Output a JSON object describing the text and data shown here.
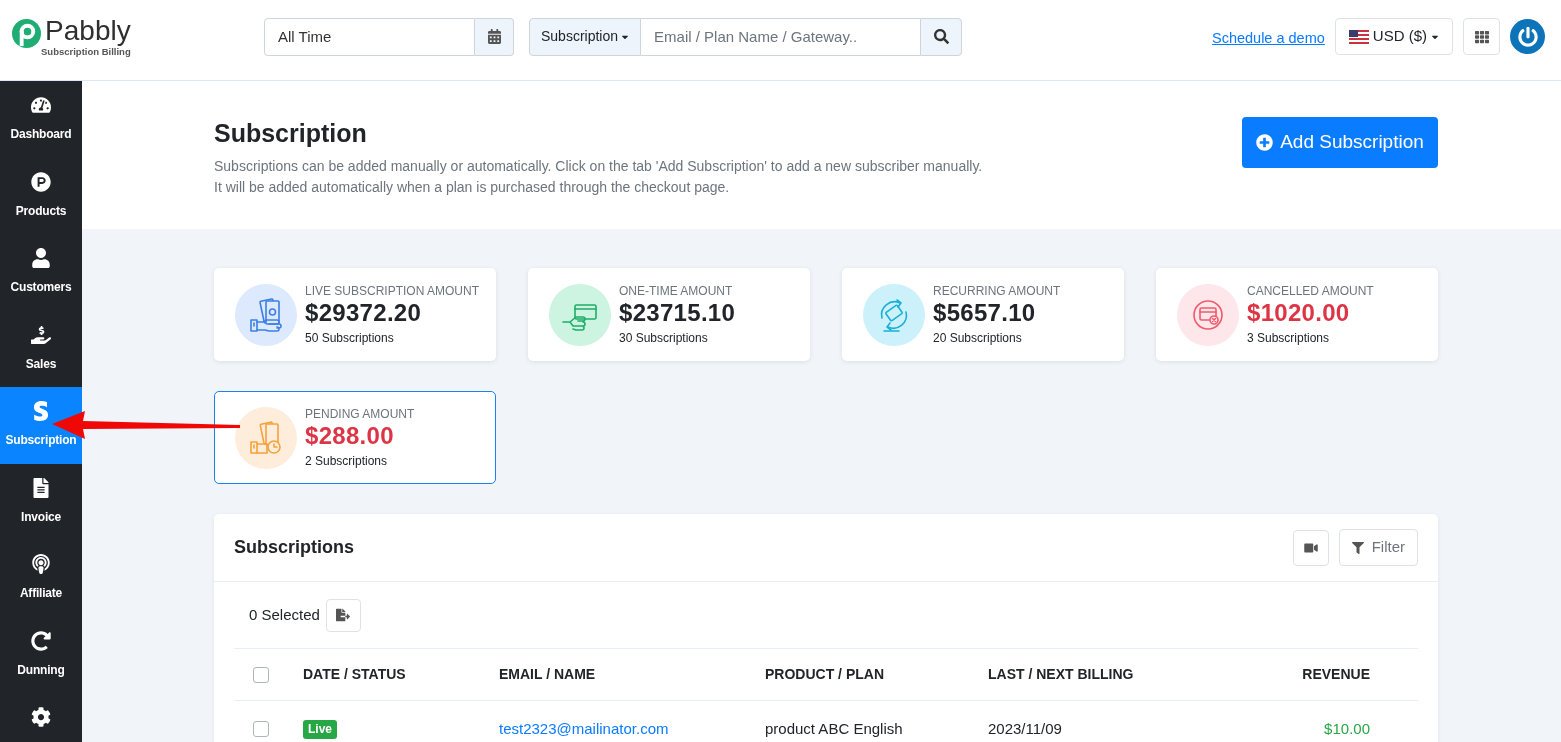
{
  "topbar": {
    "logo": {
      "name": "Pabbly",
      "tagline": "Subscription Billing"
    },
    "date_filter": {
      "value": "All Time"
    },
    "search": {
      "scope": "Subscription",
      "placeholder": "Email / Plan Name / Gateway.."
    },
    "demo_link": "Schedule a demo",
    "currency": "USD ($)"
  },
  "sidebar": {
    "items": [
      {
        "kind": "dashboard",
        "label": "Dashboard",
        "selected": false
      },
      {
        "kind": "products",
        "label": "Products",
        "selected": false
      },
      {
        "kind": "customers",
        "label": "Customers",
        "selected": false
      },
      {
        "kind": "sales",
        "label": "Sales",
        "selected": false
      },
      {
        "kind": "subscription",
        "label": "Subscription",
        "selected": true
      },
      {
        "kind": "invoice",
        "label": "Invoice",
        "selected": false
      },
      {
        "kind": "affiliate",
        "label": "Affiliate",
        "selected": false
      },
      {
        "kind": "dunning",
        "label": "Dunning",
        "selected": false
      },
      {
        "kind": "settings",
        "selected": false
      }
    ]
  },
  "page_header": {
    "title": "Subscription",
    "description": [
      "Subscriptions can be added manually or automatically. Click on the tab 'Add Subscription' to add a new subscriber manually.",
      "It will be added automatically when a plan is purchased through the checkout page."
    ],
    "add_button": "Add Subscription"
  },
  "stats": [
    {
      "kind": "live",
      "label": "LIVE SUBSCRIPTION AMOUNT",
      "amount": "$29372.20",
      "count": "50 Subscriptions",
      "selected": false
    },
    {
      "kind": "one_time",
      "label": "ONE-TIME AMOUNT",
      "amount": "$23715.10",
      "count": "30 Subscriptions",
      "selected": false
    },
    {
      "kind": "recurring",
      "label": "RECURRING AMOUNT",
      "amount": "$5657.10",
      "count": "20 Subscriptions",
      "selected": false
    },
    {
      "kind": "cancelled",
      "label": "CANCELLED AMOUNT",
      "amount": "$1020.00",
      "count": "3 Subscriptions",
      "selected": false
    },
    {
      "kind": "pending",
      "label": "PENDING AMOUNT",
      "amount": "$288.00",
      "count": "2 Subscriptions",
      "selected": true
    }
  ],
  "subscriptions": {
    "title": "Subscriptions",
    "filter_button": "Filter",
    "selection": "0 Selected",
    "select_all_checked": false,
    "columns": [
      "DATE / STATUS",
      "EMAIL / NAME",
      "PRODUCT / PLAN",
      "LAST / NEXT BILLING",
      "REVENUE"
    ],
    "rows": [
      {
        "checked": false,
        "status": "Live",
        "email": "test2323@mailinator.com",
        "product": "product ABC English",
        "billing": "2023/11/09",
        "revenue": "$10.00"
      }
    ]
  }
}
